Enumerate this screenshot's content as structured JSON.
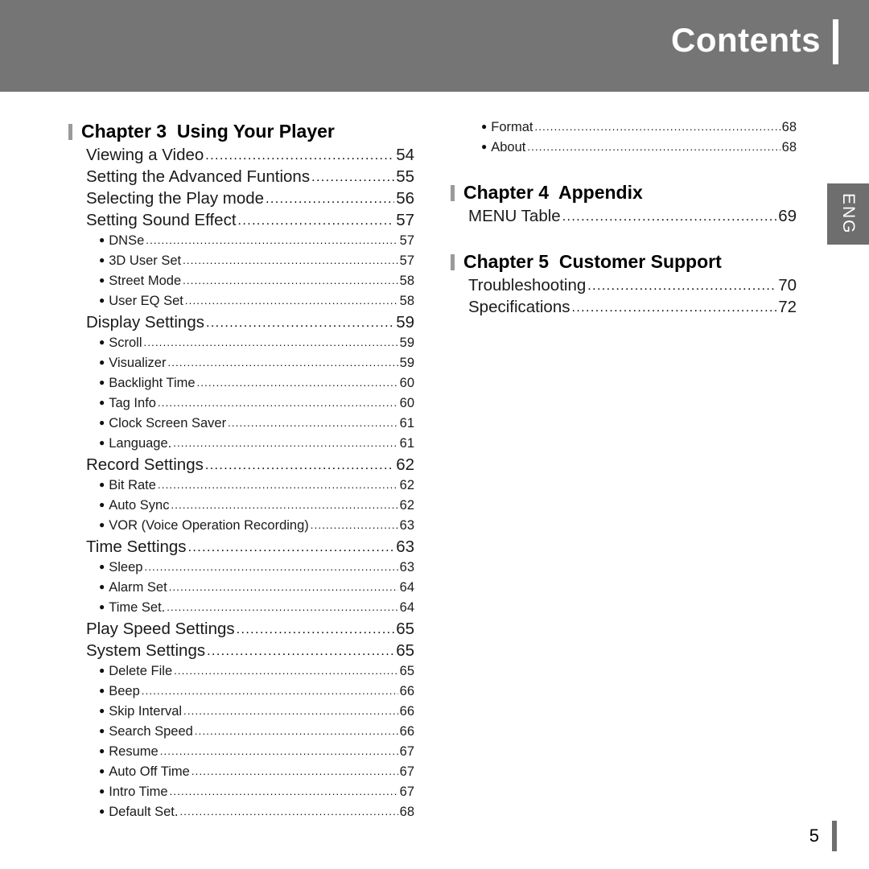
{
  "header": {
    "title": "Contents"
  },
  "side_tab": {
    "label": "ENG"
  },
  "footer": {
    "page_number": "5"
  },
  "bullet_glyph": "●",
  "left_column": {
    "chapter": {
      "number_label": "Chapter 3",
      "title": "Using Your Player",
      "full": "Chapter 3  Using Your Player"
    },
    "entries": [
      {
        "level": 1,
        "label": "Viewing a Video",
        "page": "54"
      },
      {
        "level": 1,
        "label": "Setting the Advanced Funtions",
        "page": "55"
      },
      {
        "level": 1,
        "label": "Selecting the Play mode",
        "page": "56"
      },
      {
        "level": 1,
        "label": "Setting Sound Effect",
        "page": "57"
      },
      {
        "level": 2,
        "label": "DNSe",
        "page": "57"
      },
      {
        "level": 2,
        "label": "3D User Set",
        "page": "57"
      },
      {
        "level": 2,
        "label": "Street Mode",
        "page": "58"
      },
      {
        "level": 2,
        "label": "User EQ Set",
        "page": "58"
      },
      {
        "level": 1,
        "label": "Display Settings",
        "page": "59"
      },
      {
        "level": 2,
        "label": "Scroll",
        "page": "59"
      },
      {
        "level": 2,
        "label": "Visualizer",
        "page": "59"
      },
      {
        "level": 2,
        "label": "Backlight Time",
        "page": "60"
      },
      {
        "level": 2,
        "label": "Tag Info",
        "page": "60"
      },
      {
        "level": 2,
        "label": "Clock Screen Saver",
        "page": "61"
      },
      {
        "level": 2,
        "label": "Language.",
        "page": "61"
      },
      {
        "level": 1,
        "label": "Record Settings",
        "page": "62"
      },
      {
        "level": 2,
        "label": "Bit Rate",
        "page": "62"
      },
      {
        "level": 2,
        "label": "Auto Sync",
        "page": "62"
      },
      {
        "level": 2,
        "label": "VOR (Voice Operation Recording)",
        "page": "63"
      },
      {
        "level": 1,
        "label": "Time Settings",
        "page": "63"
      },
      {
        "level": 2,
        "label": "Sleep",
        "page": "63"
      },
      {
        "level": 2,
        "label": "Alarm Set",
        "page": "64"
      },
      {
        "level": 2,
        "label": "Time Set.",
        "page": "64"
      },
      {
        "level": 1,
        "label": "Play Speed Settings",
        "page": "65"
      },
      {
        "level": 1,
        "label": "System Settings",
        "page": "65"
      },
      {
        "level": 2,
        "label": "Delete File",
        "page": "65"
      },
      {
        "level": 2,
        "label": "Beep",
        "page": "66"
      },
      {
        "level": 2,
        "label": "Skip Interval",
        "page": "66"
      },
      {
        "level": 2,
        "label": "Search Speed",
        "page": "66"
      },
      {
        "level": 2,
        "label": "Resume",
        "page": "67"
      },
      {
        "level": 2,
        "label": "Auto Off Time",
        "page": "67"
      },
      {
        "level": 2,
        "label": "Intro Time",
        "page": "67"
      },
      {
        "level": 2,
        "label": "Default Set.",
        "page": "68"
      }
    ]
  },
  "right_column": {
    "top_entries": [
      {
        "level": 2,
        "label": "Format",
        "page": "68"
      },
      {
        "level": 2,
        "label": "About",
        "page": "68"
      }
    ],
    "chapter4": {
      "number_label": "Chapter 4",
      "title": "Appendix",
      "full": "Chapter 4  Appendix"
    },
    "chapter4_entries": [
      {
        "level": 1,
        "label": "MENU Table",
        "page": "69"
      }
    ],
    "chapter5": {
      "number_label": "Chapter 5",
      "title": "Customer Support",
      "full": "Chapter 5  Customer Support"
    },
    "chapter5_entries": [
      {
        "level": 1,
        "label": "Troubleshooting",
        "page": "70"
      },
      {
        "level": 1,
        "label": "Specifications",
        "page": "72"
      }
    ]
  },
  "colors": {
    "header_bg": "#757575",
    "tab_bg": "#6e6e6e",
    "text": "#1a1a1a",
    "tick": "#9a9a9a"
  }
}
